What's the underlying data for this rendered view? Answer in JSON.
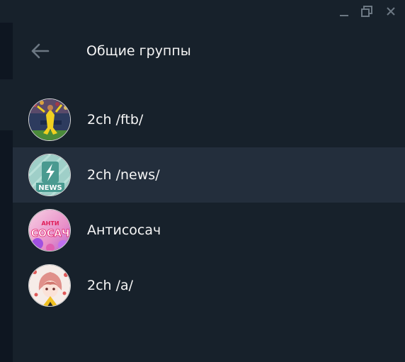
{
  "window": {
    "controls": [
      "minimize-icon",
      "maximize-icon",
      "close-icon"
    ]
  },
  "header": {
    "back_icon": "arrow-left-icon",
    "title": "Общие группы"
  },
  "groups": [
    {
      "name": "2ch /ftb/",
      "avatar": "football-avatar",
      "active": false
    },
    {
      "name": "2ch /news/",
      "avatar": "news-lightning-avatar",
      "avatar_text": "NEWS",
      "active": true
    },
    {
      "name": "Антисосач",
      "avatar": "antisosach-avatar",
      "avatar_text": "АНТИ СОСАЧ",
      "active": false
    },
    {
      "name": "2ch /a/",
      "avatar": "anime-avatar",
      "active": false
    }
  ],
  "colors": {
    "background": "#17212b",
    "active_row": "#232e3c",
    "text": "#f5f5f5",
    "icon": "#6c7883"
  }
}
